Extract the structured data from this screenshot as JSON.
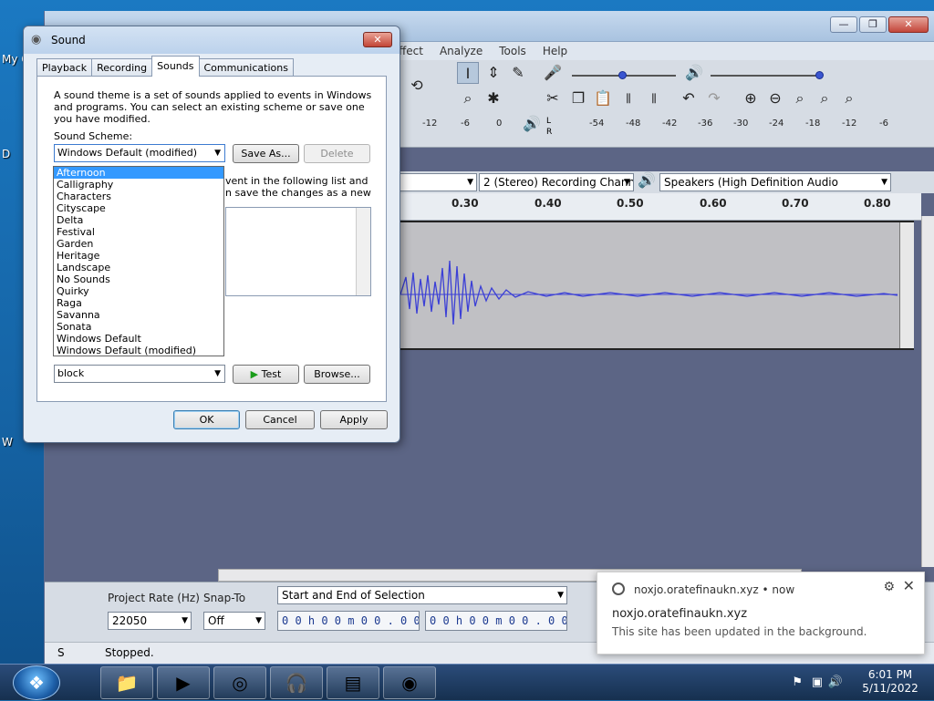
{
  "desktop": {
    "label_top": "My C",
    "label_mid": "D",
    "label_low": "W"
  },
  "audacity": {
    "menus": [
      "ffect",
      "Analyze",
      "Tools",
      "Help"
    ],
    "win_buttons": {
      "minimize": "—",
      "restore": "❐",
      "close": "✕"
    },
    "meter_ticks_rec": [
      "-12",
      "-6",
      "0"
    ],
    "meter_ticks_play": [
      "-54",
      "-48",
      "-42",
      "-36",
      "-30",
      "-24",
      "-18",
      "-12",
      "-6"
    ],
    "meter_letters": {
      "left": "L",
      "right": "R"
    },
    "channels_combo": "2 (Stereo) Recording Chann",
    "output_combo": "Speakers (High Definition Audio",
    "ruler_ticks": [
      "0.30",
      "0.40",
      "0.50",
      "0.60",
      "0.70",
      "0.80"
    ],
    "project_rate_label": "Project Rate (Hz)",
    "snap_to_label": "Snap-To",
    "project_rate_value": "22050",
    "snap_to_value": "Off",
    "selection_mode": "Start and End of Selection",
    "time_start": "0 0 h 0 0 m 0 0 . 0 0 0 s",
    "time_end": "0 0 h 0 0 m 0 0 . 0 0 0 s",
    "status": "Stopped.",
    "status_prefix": "S"
  },
  "dialog": {
    "title": "Sound",
    "close_label": "✕",
    "tabs": [
      "Playback",
      "Recording",
      "Sounds",
      "Communications"
    ],
    "description": "A sound theme is a set of sounds applied to events in Windows and programs.  You can select an existing scheme or save one you have modified.",
    "scheme_label": "Sound Scheme:",
    "scheme_value": "Windows Default (modified)",
    "save_as": "Save As...",
    "delete": "Delete",
    "behind_text_1": "vent in the following list and",
    "behind_text_2": "n save the changes as a new",
    "dropdown_options": [
      "Afternoon",
      "Calligraphy",
      "Characters",
      "Cityscape",
      "Delta",
      "Festival",
      "Garden",
      "Heritage",
      "Landscape",
      "No Sounds",
      "Quirky",
      "Raga",
      "Savanna",
      "Sonata",
      "Windows Default",
      "Windows Default (modified)"
    ],
    "sound_value": "block",
    "test": "Test",
    "browse": "Browse...",
    "ok": "OK",
    "cancel": "Cancel",
    "apply": "Apply"
  },
  "notification": {
    "source": "noxjo.oratefinaukn.xyz  •  now",
    "heading": "noxjo.oratefinaukn.xyz",
    "body": "This site has been updated in the background."
  },
  "taskbar": {
    "time": "6:01 PM",
    "date": "5/11/2022"
  }
}
